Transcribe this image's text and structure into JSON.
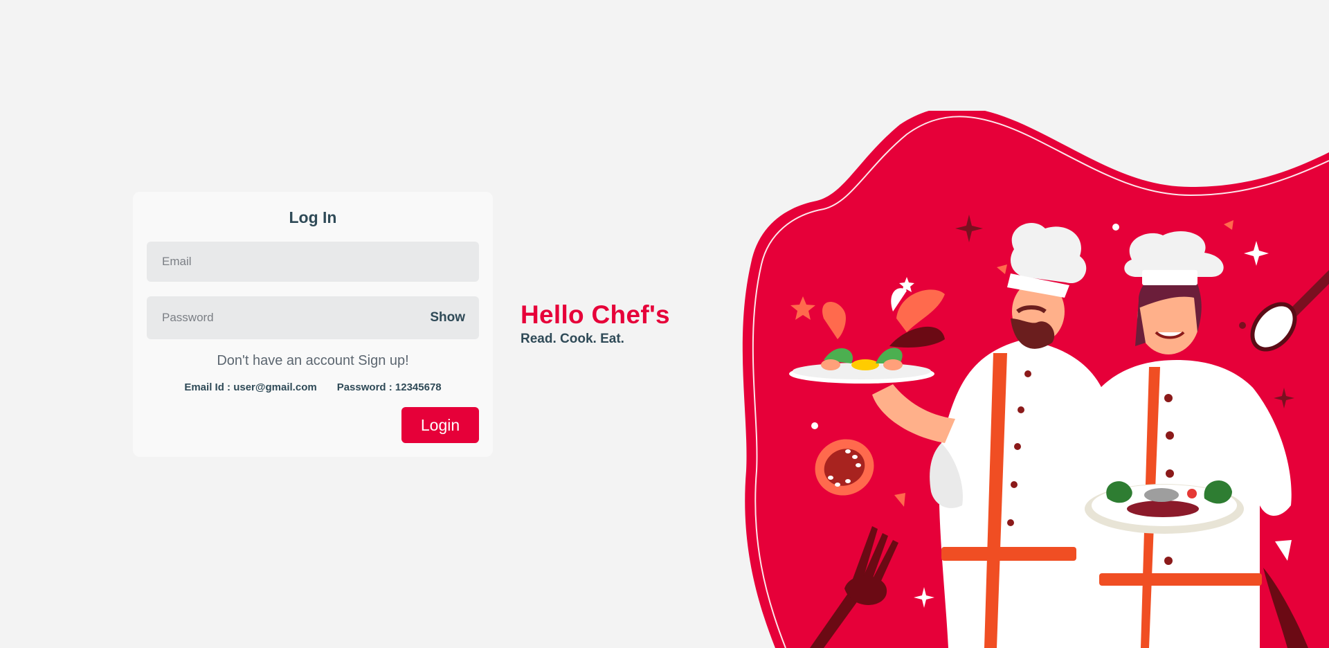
{
  "login": {
    "title": "Log In",
    "email_placeholder": "Email",
    "password_placeholder": "Password",
    "show_label": "Show",
    "signup_text": "Don't have an account Sign up!",
    "demo_email": "Email Id : user@gmail.com",
    "demo_password": "Password : 12345678",
    "login_label": "Login"
  },
  "hero": {
    "title": "Hello Chef's",
    "subtitle": "Read. Cook. Eat."
  },
  "colors": {
    "accent": "#e60039",
    "text_dark": "#2f4a57",
    "background": "#f3f3f3",
    "card": "#f9f9f9",
    "input": "#e8e9ea"
  },
  "icons": {
    "illustration": "chefs-illustration",
    "fork": "fork-icon",
    "knife": "knife-icon",
    "spoon": "spoon-icon",
    "tomato": "tomato-icon"
  }
}
